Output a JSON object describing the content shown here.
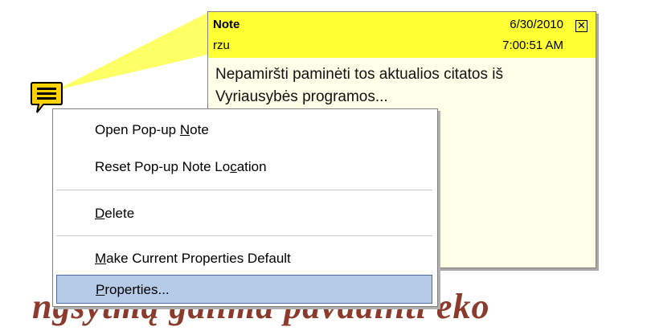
{
  "background_text": "ngsytmą galima pavadinti eko",
  "note": {
    "title": "Note",
    "author": "rzu",
    "date": "6/30/2010",
    "time": "7:00:51 AM",
    "body": "Nepamiršti paminėti tos aktualios citatos iš Vyriausybės programos..."
  },
  "menu": {
    "items": [
      {
        "label": "Open Pop-up Note",
        "pre": "Open Pop-up ",
        "acc": "N",
        "post": "ote"
      },
      {
        "label": "Reset Pop-up Note Location",
        "pre": "Reset Pop-up Note Lo",
        "acc": "c",
        "post": "ation"
      },
      {
        "label": "Delete",
        "pre": "",
        "acc": "D",
        "post": "elete"
      },
      {
        "label": "Make Current Properties Default",
        "pre": "",
        "acc": "M",
        "post": "ake Current Properties Default"
      },
      {
        "label": "Properties...",
        "pre": "",
        "acc": "P",
        "post": "roperties..."
      }
    ]
  },
  "colors": {
    "note_header": "#ffff33",
    "note_icon": "#ffd200",
    "selected_item": "#b6cbe8"
  }
}
